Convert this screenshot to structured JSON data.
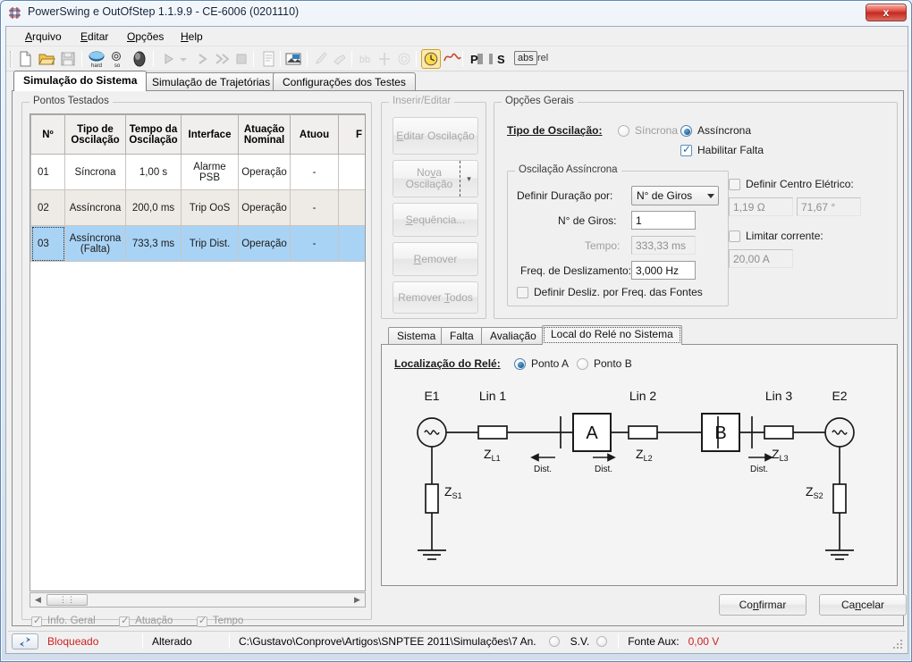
{
  "window": {
    "title": "PowerSwing e OutOfStep 1.1.9.9 - CE-6006 (0201110)",
    "close_label": "x",
    "app_icon": "app-icon"
  },
  "menubar": [
    {
      "label": "Arquivo",
      "mnemonic": "A"
    },
    {
      "label": "Editar",
      "mnemonic": "E"
    },
    {
      "label": "Opções",
      "mnemonic": "O"
    },
    {
      "label": "Help",
      "mnemonic": "H"
    }
  ],
  "toolbar": {
    "icons": [
      "new-file-icon",
      "open-folder-icon",
      "save-disk-icon",
      "hardware-icon",
      "software-icon",
      "mouse-icon",
      "play-icon",
      "play-dropdown-icon",
      "step-icon",
      "fast-forward-icon",
      "stop-icon",
      "report-icon",
      "export-icon",
      "brush-icon",
      "eraser-icon",
      "pointer-cross-icon",
      "crosshair-icon",
      "spiral-icon",
      "clock-icon",
      "sine-wave-icon",
      "phasor-p-icon",
      "phasor-s-icon"
    ],
    "abs_label": "abs",
    "rel_label": "rel"
  },
  "tabs": [
    {
      "label": "Simulação do Sistema",
      "active": true
    },
    {
      "label": "Simulação de Trajetórias",
      "active": false
    },
    {
      "label": "Configurações dos Testes",
      "active": false
    }
  ],
  "pontos_testados": {
    "group_label": "Pontos Testados",
    "columns": [
      "Nº",
      "Tipo de Oscilação",
      "Tempo da Oscilação",
      "Interface",
      "Atuação Nominal",
      "Atuou",
      "F"
    ],
    "rows": [
      {
        "n": "01",
        "tipo": "Síncrona",
        "tempo": "1,00 s",
        "interface": "Alarme PSB",
        "atuacao": "Operação",
        "atuou": "-",
        "f": ""
      },
      {
        "n": "02",
        "tipo": "Assíncrona",
        "tempo": "200,0 ms",
        "interface": "Trip OoS",
        "atuacao": "Operação",
        "atuou": "-",
        "f": ""
      },
      {
        "n": "03",
        "tipo": "Assíncrona (Falta)",
        "tempo": "733,3 ms",
        "interface": "Trip Dist.",
        "atuacao": "Operação",
        "atuou": "-",
        "f": ""
      }
    ],
    "footer_checks": [
      {
        "label": "Info. Geral",
        "checked": true,
        "enabled": false
      },
      {
        "label": "Atuação",
        "checked": true,
        "enabled": false
      },
      {
        "label": "Tempo",
        "checked": true,
        "enabled": false
      }
    ],
    "scroll_left_icon": "scroll-left-arrow-icon",
    "scroll_right_icon": "scroll-right-arrow-icon"
  },
  "inserir_editar": {
    "group_label": "Inserir/Editar",
    "buttons": [
      {
        "label": "Editar Oscilação",
        "mnemonic": "E"
      },
      {
        "label": "Nova Oscilação",
        "mnemonic": "v",
        "split": true
      },
      {
        "label": "Sequência...",
        "mnemonic": "S"
      },
      {
        "label": "Remover",
        "mnemonic": "R"
      },
      {
        "label": "Remover Todos",
        "mnemonic": "T"
      }
    ]
  },
  "opcoes_gerais": {
    "group_label": "Opções Gerais",
    "tipo_label": "Tipo de Oscilação:",
    "tipo_options": [
      {
        "label": "Síncrona",
        "selected": false,
        "enabled": false
      },
      {
        "label": "Assíncrona",
        "selected": true,
        "enabled": true
      }
    ],
    "habilitar_falta": {
      "label": "Habilitar Falta",
      "checked": true
    },
    "oscilacao_assincrona": {
      "group_label": "Oscilação Assíncrona",
      "definir_duracao_label": "Definir Duração por:",
      "definir_duracao_value": "N° de Giros",
      "n_giros_label": "N° de Giros:",
      "n_giros_value": "1",
      "tempo_label": "Tempo:",
      "tempo_value": "333,33 ms",
      "freq_label": "Freq. de Deslizamento:",
      "freq_value": "3,000 Hz",
      "desliz_fontes": {
        "label": "Definir Desliz. por Freq. das Fontes",
        "checked": false
      }
    },
    "centro_eletrico": {
      "label": "Definir Centro Elétrico:",
      "checked": false,
      "impedance_value": "1,19 Ω",
      "angle_value": "71,67 °"
    },
    "limitar_corrente": {
      "label": "Limitar corrente:",
      "checked": false,
      "value": "20,00 A"
    }
  },
  "bottom_panel": {
    "tabs": [
      {
        "label": "Sistema",
        "active": false
      },
      {
        "label": "Falta",
        "active": false
      },
      {
        "label": "Avaliação",
        "active": false
      },
      {
        "label": "Local do Relé no Sistema",
        "active": true
      }
    ],
    "localizacao_label": "Localização do Relé:",
    "localizacao_options": [
      {
        "label": "Ponto A",
        "selected": true
      },
      {
        "label": "Ponto B",
        "selected": false
      }
    ],
    "diagram": {
      "sources": [
        {
          "name": "E1",
          "impedance": "Z",
          "impedance_sub": "S1"
        },
        {
          "name": "E2",
          "impedance": "Z",
          "impedance_sub": "S2"
        }
      ],
      "lines": [
        {
          "name": "Lin 1",
          "impedance": "Z",
          "impedance_sub": "L1"
        },
        {
          "name": "Lin 2",
          "impedance": "Z",
          "impedance_sub": "L2"
        },
        {
          "name": "Lin 3",
          "impedance": "Z",
          "impedance_sub": "L3"
        }
      ],
      "relays": [
        {
          "label": "A"
        },
        {
          "label": "B"
        }
      ],
      "dist_labels": [
        "Dist.",
        "Dist.",
        "Dist."
      ]
    }
  },
  "dialog_buttons": [
    {
      "label": "Confirmar",
      "mnemonic": "C"
    },
    {
      "label": "Cancelar",
      "mnemonic": "n"
    }
  ],
  "statusbar": {
    "sync_icon": "sync-arrows-icon",
    "state": "Bloqueado",
    "changed": "Alterado",
    "path": "C:\\Gustavo\\Conprove\\Artigos\\SNPTEE 2011\\Simulações\\7 An.",
    "an_led": "an-led-icon",
    "sv_label": "S.V.",
    "sv_led": "sv-led-icon",
    "fonte_aux_label": "Fonte Aux:",
    "fonte_aux_value": "0,00 V"
  },
  "colors": {
    "accent_selection": "#a9d3f5",
    "status_red": "#cc2222",
    "toolbar_pressed": "#ffe9a8"
  }
}
